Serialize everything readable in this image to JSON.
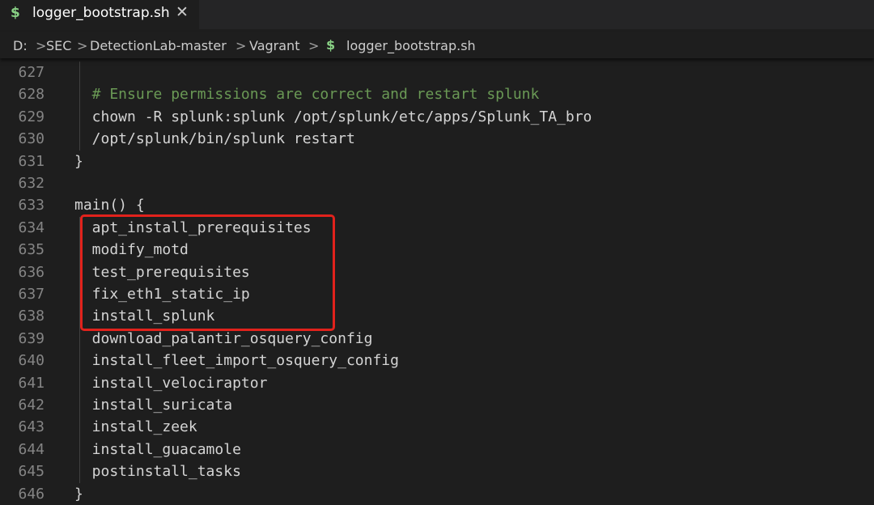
{
  "tab": {
    "icon": "$",
    "label": "logger_bootstrap.sh",
    "close": "✕"
  },
  "breadcrumb": {
    "items": [
      "D:",
      "SEC",
      "DetectionLab-master",
      "Vagrant"
    ],
    "separator": ">",
    "file_icon": "$",
    "file": "logger_bootstrap.sh"
  },
  "editor": {
    "lines": [
      {
        "num": "627",
        "text": "",
        "kind": "code"
      },
      {
        "num": "628",
        "text": "  # Ensure permissions are correct and restart splunk",
        "kind": "comment"
      },
      {
        "num": "629",
        "text": "  chown -R splunk:splunk /opt/splunk/etc/apps/Splunk_TA_bro",
        "kind": "code"
      },
      {
        "num": "630",
        "text": "  /opt/splunk/bin/splunk restart",
        "kind": "code"
      },
      {
        "num": "631",
        "text": "}",
        "kind": "code"
      },
      {
        "num": "632",
        "text": "",
        "kind": "code"
      },
      {
        "num": "633",
        "text": "main() {",
        "kind": "code"
      },
      {
        "num": "634",
        "text": "  apt_install_prerequisites",
        "kind": "code"
      },
      {
        "num": "635",
        "text": "  modify_motd",
        "kind": "code"
      },
      {
        "num": "636",
        "text": "  test_prerequisites",
        "kind": "code"
      },
      {
        "num": "637",
        "text": "  fix_eth1_static_ip",
        "kind": "code"
      },
      {
        "num": "638",
        "text": "  install_splunk",
        "kind": "code"
      },
      {
        "num": "639",
        "text": "  download_palantir_osquery_config",
        "kind": "code"
      },
      {
        "num": "640",
        "text": "  install_fleet_import_osquery_config",
        "kind": "code"
      },
      {
        "num": "641",
        "text": "  install_velociraptor",
        "kind": "code"
      },
      {
        "num": "642",
        "text": "  install_suricata",
        "kind": "code"
      },
      {
        "num": "643",
        "text": "  install_zeek",
        "kind": "code"
      },
      {
        "num": "644",
        "text": "  install_guacamole",
        "kind": "code"
      },
      {
        "num": "645",
        "text": "  postinstall_tasks",
        "kind": "code"
      },
      {
        "num": "646",
        "text": "}",
        "kind": "code"
      }
    ]
  },
  "colors": {
    "background": "#1e1e1e",
    "code_text": "#d4d4d4",
    "comment": "#6a9955",
    "line_number": "#858585",
    "shell_icon": "#89d185",
    "highlight_box": "#e1221c"
  }
}
